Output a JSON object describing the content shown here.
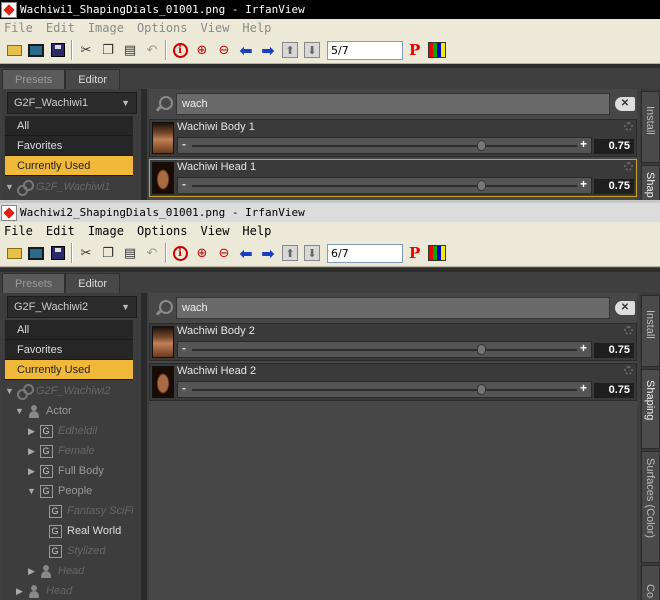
{
  "window1": {
    "title": "Wachiwi1_ShapingDials_01001.png - IrfanView",
    "menu": [
      "File",
      "Edit",
      "Image",
      "Options",
      "View",
      "Help"
    ],
    "page_counter": "5/7",
    "tabs": [
      "Presets",
      "Editor"
    ],
    "active_tab": "Editor",
    "preset_dropdown": "G2F_Wachiwi1",
    "filters": [
      "All",
      "Favorites",
      "Currently Used"
    ],
    "tree_root": "G2F_Wachiwi1",
    "search_value": "wach",
    "dials": [
      {
        "name": "Wachiwi Body 1",
        "value": "0.75"
      },
      {
        "name": "Wachiwi Head 1",
        "value": "0.75"
      }
    ],
    "side_tabs": [
      "Install",
      "Shap"
    ]
  },
  "window2": {
    "title": "Wachiwi2_ShapingDials_01001.png - IrfanView",
    "menu": [
      "File",
      "Edit",
      "Image",
      "Options",
      "View",
      "Help"
    ],
    "page_counter": "6/7",
    "tabs": [
      "Presets",
      "Editor"
    ],
    "active_tab": "Editor",
    "preset_dropdown": "G2F_Wachiwi2",
    "filters": [
      "All",
      "Favorites",
      "Currently Used"
    ],
    "tree": [
      {
        "label": "G2F_Wachiwi2",
        "icon": "link-icon"
      },
      {
        "label": "Actor",
        "icon": "figure-icon"
      },
      {
        "label": "Edheldil",
        "icon": "group-icon"
      },
      {
        "label": "Female",
        "icon": "group-icon"
      },
      {
        "label": "Full Body",
        "icon": "group-icon"
      },
      {
        "label": "People",
        "icon": "group-icon"
      },
      {
        "label": "Fantasy SciFi",
        "icon": "group-icon"
      },
      {
        "label": "Real World",
        "icon": "group-icon"
      },
      {
        "label": "Stylized",
        "icon": "group-icon"
      },
      {
        "label": "Head",
        "icon": "figure-icon"
      },
      {
        "label": "Head",
        "icon": "figure-icon"
      }
    ],
    "search_value": "wach",
    "dials": [
      {
        "name": "Wachiwi Body 2",
        "value": "0.75"
      },
      {
        "name": "Wachiwi Head 2",
        "value": "0.75"
      }
    ],
    "side_tabs": [
      "Install",
      "Shaping",
      "Surfaces (Color)",
      "Co"
    ]
  },
  "dial_slider_level": 0.75,
  "colors": {
    "highlight": "#f0b93a",
    "panel_bg": "#3f3f3f",
    "irfan_toolbar": "#ece9d8"
  }
}
